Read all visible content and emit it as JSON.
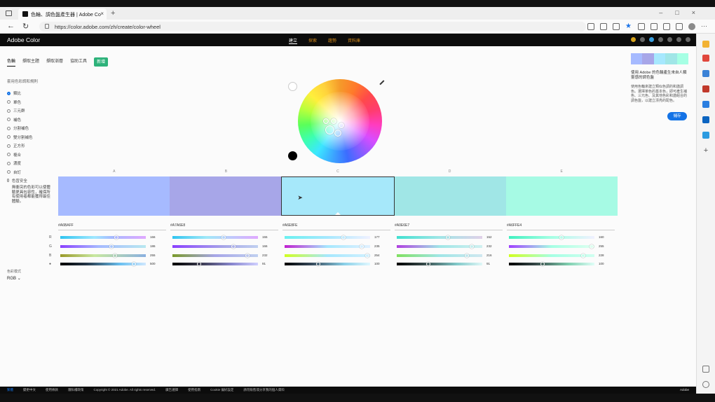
{
  "browser": {
    "tab_title": "色輪、調色盤產生器 | Adobe Co",
    "url": "https://color.adobe.com/zh/create/color-wheel"
  },
  "site": {
    "brand": "Adobe Color",
    "menu": [
      "建立",
      "探索",
      "趨勢",
      "資料庫"
    ]
  },
  "subtabs": {
    "items": [
      "色輪",
      "擷取主題",
      "擷取漸層",
      "協助工具"
    ],
    "beta": "新增"
  },
  "harmony": {
    "title": "套用色彩調和規則",
    "rules": [
      "類比",
      "單色",
      "三元群",
      "補色",
      "分割補色",
      "雙分割補色",
      "正方形",
      "複合",
      "濃度",
      "自訂"
    ],
    "selected_index": 0,
    "color_blind_label": "色盲安全",
    "note": "無衝突的色彩可以使體驗更具包容性，確保所有使用者都能獲得最佳體驗。",
    "mode_label": "色彩模式",
    "mode_value": "RGB"
  },
  "swatches": {
    "labels": [
      "A",
      "B",
      "C",
      "D",
      "E"
    ],
    "colors": [
      "#A6BAFF",
      "#A7A6E8",
      "#A6E8FA",
      "#A0E6E6",
      "#A6FAE4"
    ],
    "hex": [
      "#A6BAFF",
      "#A7A6E8",
      "#A6E8FE",
      "#A0E6E7",
      "#A6FFE4"
    ],
    "selected_index": 2
  },
  "sliders": {
    "channel_labels": [
      "R",
      "G",
      "B",
      "●"
    ],
    "values": [
      [
        "166",
        "186",
        "255",
        "500"
      ],
      [
        "155",
        "166",
        "232",
        "91"
      ],
      [
        "177",
        "235",
        "254",
        "100"
      ],
      [
        "152",
        "232",
        "216",
        "91"
      ],
      [
        "160",
        "255",
        "228",
        "100"
      ]
    ]
  },
  "right_panel": {
    "palette": [
      "#A6BAFF",
      "#A7A6E8",
      "#A6E8FE",
      "#A0E6E7",
      "#A6FFE4"
    ],
    "title": "使用 Adobe 的色輪產生來自人類靈感的調色盤",
    "text": "使用色輪來建立類似色調的和諧調色。選擇單色的基本色，即可產生補色、三元色、及其他色彩和諧組合的調色盤，以建立漂亮的配色。",
    "save_label": "儲存"
  },
  "footer": {
    "items": [
      "繁體",
      "變更中文",
      "使用條款",
      "隱私權政策",
      "Copyright © 2021 Adobe. All rights reserved.",
      "廣告選擇",
      "使用指南",
      "Cookie 偏好設定",
      "請勿販售或分享我的個人資料"
    ],
    "brand": "Adobe"
  }
}
